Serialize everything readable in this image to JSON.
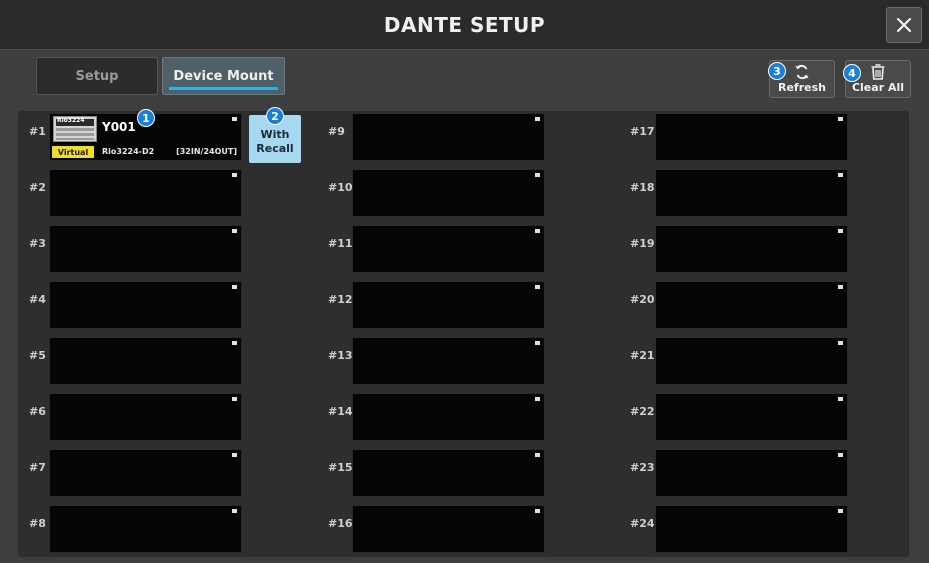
{
  "window": {
    "title": "DANTE SETUP"
  },
  "tabs": [
    {
      "label": "Setup",
      "active": false
    },
    {
      "label": "Device Mount",
      "active": true
    }
  ],
  "toolbar": {
    "refresh_label": "Refresh",
    "refresh_icon": "refresh-icon",
    "clear_label": "Clear All",
    "clear_icon": "trash-icon"
  },
  "callouts": [
    "1",
    "2",
    "3",
    "4"
  ],
  "slots": [
    {
      "label": "#1",
      "device": {
        "name": "Y001",
        "badge": "Virtual",
        "model": "Rio3224-D2",
        "io": "[32IN/24OUT]",
        "thumb_text": "Rio3224"
      }
    },
    {
      "label": "#2"
    },
    {
      "label": "#3"
    },
    {
      "label": "#4"
    },
    {
      "label": "#5"
    },
    {
      "label": "#6"
    },
    {
      "label": "#7"
    },
    {
      "label": "#8"
    },
    {
      "label": "#9"
    },
    {
      "label": "#10"
    },
    {
      "label": "#11"
    },
    {
      "label": "#12"
    },
    {
      "label": "#13"
    },
    {
      "label": "#14"
    },
    {
      "label": "#15"
    },
    {
      "label": "#16"
    },
    {
      "label": "#17"
    },
    {
      "label": "#18"
    },
    {
      "label": "#19"
    },
    {
      "label": "#20"
    },
    {
      "label": "#21"
    },
    {
      "label": "#22"
    },
    {
      "label": "#23"
    },
    {
      "label": "#24"
    }
  ],
  "with_recall": {
    "line1": "With",
    "line2": "Recall"
  },
  "colors": {
    "accent_underline": "#2fb0ea",
    "recall_button": "#a8d8f0",
    "virtual_badge": "#f2dc2a",
    "callout": "#1a7fd8"
  }
}
